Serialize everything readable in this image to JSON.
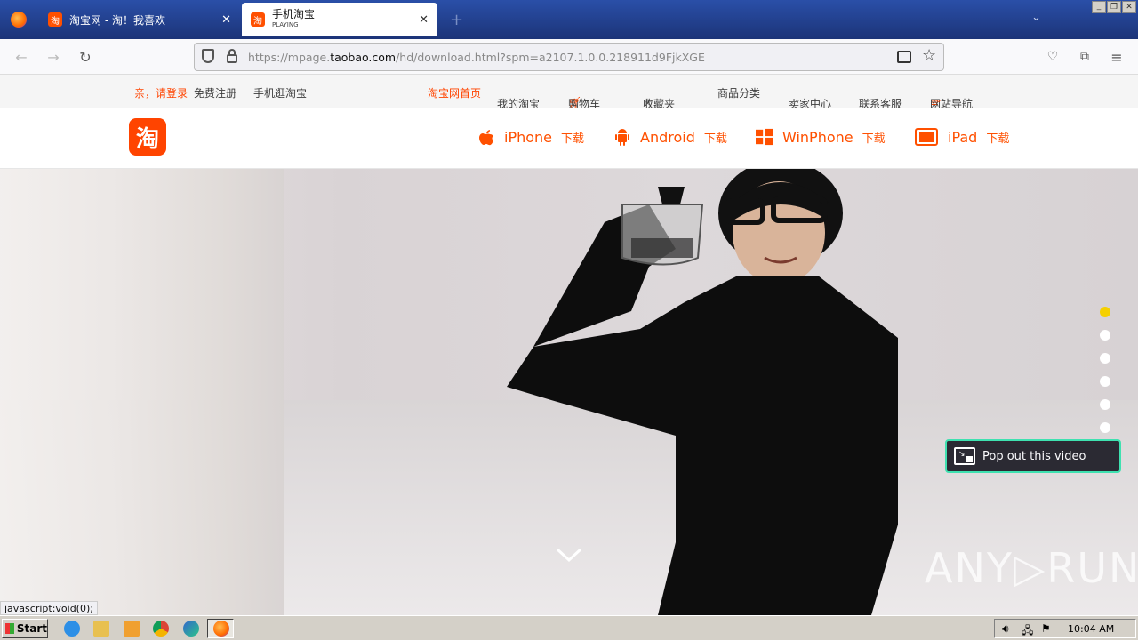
{
  "browser": {
    "tabs": [
      {
        "favicon": "淘",
        "title": "淘宝网 - 淘！我喜欢",
        "active": false
      },
      {
        "favicon": "淘",
        "title": "手机淘宝",
        "subtitle": "PLAYING",
        "active": true
      }
    ],
    "url_prefix": "https://mpage.",
    "url_domain": "taobao.com",
    "url_path": "/hd/download.html?spm=a2107.1.0.0.218911d9FjkXGE",
    "status_text": "javascript:void(0);"
  },
  "topnav": {
    "login": "亲，请登录",
    "register": "免费注册",
    "mobile": "手机逛淘宝",
    "home": "淘宝网首页",
    "my_taobao": "我的淘宝",
    "cart": "购物车",
    "favorites": "收藏夹",
    "categories": "商品分类",
    "seller": "卖家中心",
    "service": "联系客服",
    "sitenav": "网站导航"
  },
  "header": {
    "logo": "淘",
    "downloads": [
      {
        "name": "iPhone",
        "suffix": "下载",
        "icon": "apple-icon"
      },
      {
        "name": "Android",
        "suffix": "下载",
        "icon": "android-icon"
      },
      {
        "name": "WinPhone",
        "suffix": "下载",
        "icon": "windows-icon"
      },
      {
        "name": "iPad",
        "suffix": "下载",
        "icon": "ipad-icon"
      }
    ]
  },
  "hero": {
    "pip_label": "Pop out this video",
    "active_dot_color": "#f5d000",
    "dot_count": 6,
    "active_dot": 1
  },
  "watermark": "ANY▷RUN",
  "taskbar": {
    "start": "Start",
    "time": "10:04 AM"
  }
}
